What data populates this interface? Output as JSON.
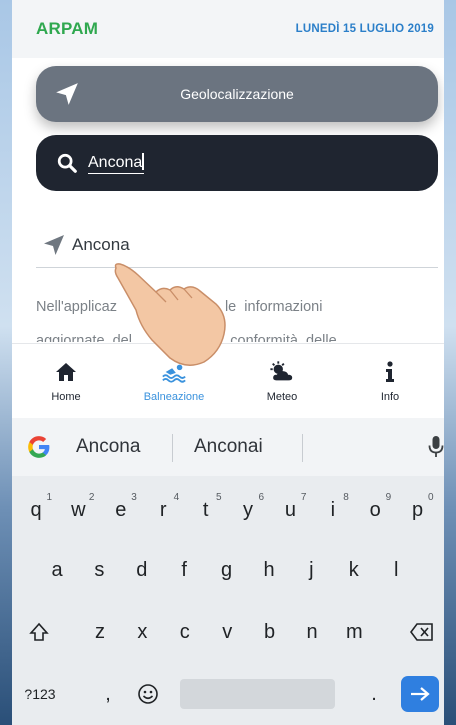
{
  "header": {
    "brand": "ARPAM",
    "date": "LUNEDÌ 15 LUGLIO 2019"
  },
  "geolocate": {
    "label": "Geolocalizzazione",
    "icon": "navigation-arrow-icon"
  },
  "search": {
    "value": "Ancona",
    "icon": "search-icon"
  },
  "suggestion": {
    "text": "Ancona",
    "icon": "navigation-arrow-icon"
  },
  "paragraph": {
    "line1": "Nell'applicaz         contenute  le  informazioni",
    "line2": "aggiornate  del          atico  di  conformità  delle"
  },
  "nav": {
    "items": [
      {
        "label": "Home",
        "icon": "home-icon"
      },
      {
        "label": "Balneazione",
        "icon": "swimmer-icon",
        "active": true
      },
      {
        "label": "Meteo",
        "icon": "weather-icon"
      },
      {
        "label": "Info",
        "icon": "info-icon"
      }
    ]
  },
  "keyboard": {
    "suggestions": [
      "Ancona",
      "Anconai"
    ],
    "row1": [
      {
        "k": "q",
        "s": "1"
      },
      {
        "k": "w",
        "s": "2"
      },
      {
        "k": "e",
        "s": "3"
      },
      {
        "k": "r",
        "s": "4"
      },
      {
        "k": "t",
        "s": "5"
      },
      {
        "k": "y",
        "s": "6"
      },
      {
        "k": "u",
        "s": "7"
      },
      {
        "k": "i",
        "s": "8"
      },
      {
        "k": "o",
        "s": "9"
      },
      {
        "k": "p",
        "s": "0"
      }
    ],
    "row2": [
      "a",
      "s",
      "d",
      "f",
      "g",
      "h",
      "j",
      "k",
      "l"
    ],
    "row3": [
      "z",
      "x",
      "c",
      "v",
      "b",
      "n",
      "m"
    ],
    "symbols_label": "?123",
    "comma": ",",
    "period": "."
  },
  "colors": {
    "brand": "#2fa84f",
    "date": "#2b7fc9",
    "geo_button": "#6b7480",
    "search_bg": "#1f2530",
    "active_nav": "#3a92dd",
    "enter_key": "#2f7fe0"
  }
}
